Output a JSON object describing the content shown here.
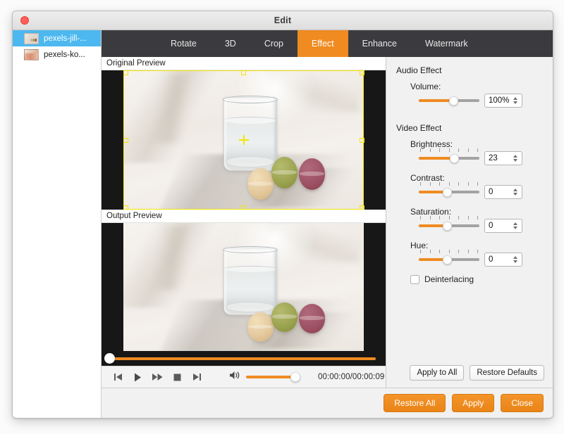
{
  "window": {
    "title": "Edit",
    "close_button": "close-button"
  },
  "sidebar": {
    "files": [
      {
        "name": "pexels-jill-...",
        "selected": true
      },
      {
        "name": "pexels-ko...",
        "selected": false
      }
    ]
  },
  "tabs": [
    {
      "label": "Rotate",
      "active": false
    },
    {
      "label": "3D",
      "active": false
    },
    {
      "label": "Crop",
      "active": false
    },
    {
      "label": "Effect",
      "active": true
    },
    {
      "label": "Enhance",
      "active": false
    },
    {
      "label": "Watermark",
      "active": false
    }
  ],
  "preview": {
    "original_label": "Original Preview",
    "output_label": "Output Preview",
    "timeline_position_percent": 0,
    "transport": {
      "previous": "previous-frame",
      "play": "play",
      "forward": "fast-forward",
      "stop": "stop",
      "next": "next-frame",
      "volume_icon": "volume-icon",
      "volume_percent": 100,
      "time": "00:00:00/00:00:09"
    }
  },
  "settings": {
    "audio_group": "Audio Effect",
    "video_group": "Video Effect",
    "volume": {
      "label": "Volume:",
      "value": "100%",
      "percent": 62
    },
    "brightness": {
      "label": "Brightness:",
      "value": "23",
      "percent": 61
    },
    "contrast": {
      "label": "Contrast:",
      "value": "0",
      "percent": 50
    },
    "saturation": {
      "label": "Saturation:",
      "value": "0",
      "percent": 50
    },
    "hue": {
      "label": "Hue:",
      "value": "0",
      "percent": 50
    },
    "deinterlacing": {
      "label": "Deinterlacing",
      "checked": false
    },
    "apply_to_all": "Apply to All",
    "restore_defaults": "Restore Defaults"
  },
  "footer": {
    "restore_all": "Restore All",
    "apply": "Apply",
    "close": "Close"
  },
  "colors": {
    "accent": "#ef8b21",
    "tabbar": "#3b3b3f",
    "selection": "#4db8ef",
    "crop_outline": "#f3e500"
  }
}
